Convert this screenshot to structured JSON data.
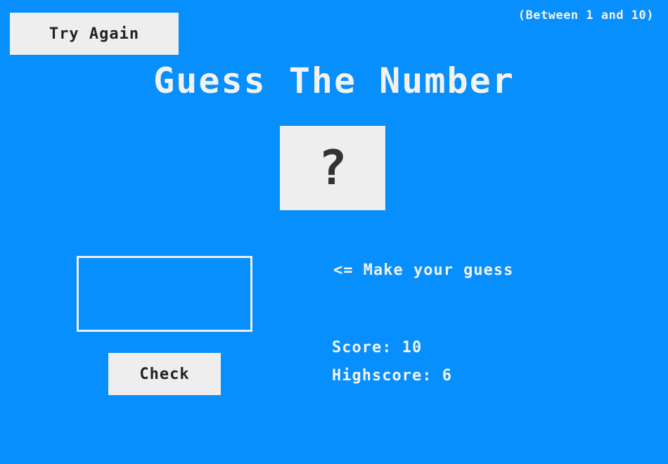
{
  "header": {
    "try_again_label": "Try Again",
    "range_hint": "(Between 1 and 10)",
    "title": "Guess The Number"
  },
  "secret": {
    "display": "?"
  },
  "guess": {
    "value": "",
    "placeholder": ""
  },
  "controls": {
    "check_label": "Check"
  },
  "status": {
    "message": "<= Make your guess",
    "score_label": "Score:",
    "score_value": "10",
    "highscore_label": "Highscore:",
    "highscore_value": "6"
  },
  "colors": {
    "background": "#068ffd",
    "button_bg": "#eeeeee",
    "text": "#f2f2f2"
  }
}
